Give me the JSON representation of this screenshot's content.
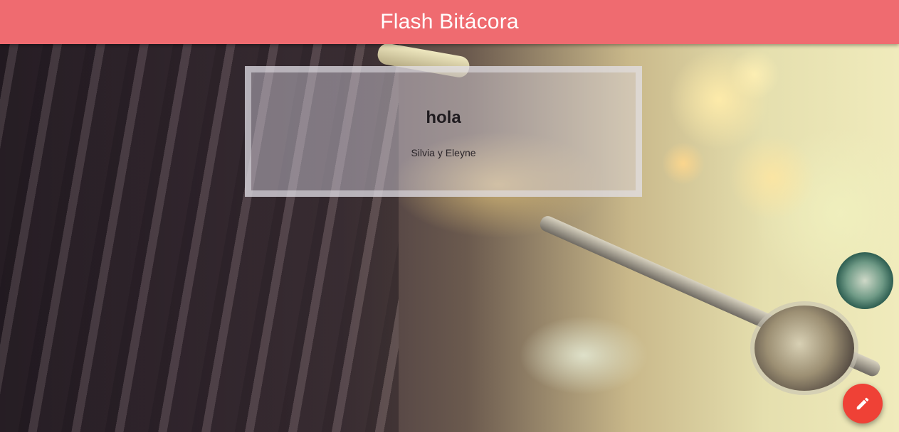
{
  "header": {
    "title": "Flash Bitácora",
    "background_color": "#ef6b70"
  },
  "posts": [
    {
      "title": "hola",
      "author": "Silvia y Eleyne"
    }
  ],
  "fab": {
    "icon": "pencil-icon",
    "color": "#ef4136"
  }
}
